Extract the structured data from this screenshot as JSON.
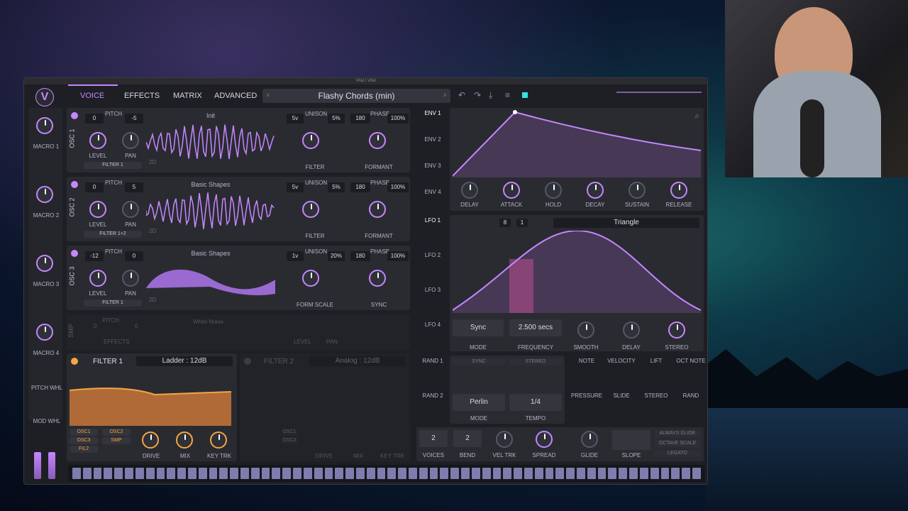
{
  "window": {
    "title": "Vital / Vital"
  },
  "tabs": [
    "VOICE",
    "EFFECTS",
    "MATRIX",
    "ADVANCED"
  ],
  "preset": {
    "name": "Flashy Chords (min)"
  },
  "macros": [
    "MACRO 1",
    "MACRO 2",
    "MACRO 3",
    "MACRO 4"
  ],
  "side": {
    "pitch_whl": "PITCH WHL",
    "mod_whl": "MOD WHL"
  },
  "osc": [
    {
      "label": "OSC 1",
      "pitch_a": "0",
      "pitch_b": "-5",
      "wave": "Init",
      "dim": "2D",
      "filter": "FILTER 1",
      "uni_a": "5v",
      "uni_b": "5%",
      "phase_a": "180",
      "phase_b": "100%",
      "knob_a": "FILTER",
      "knob_b": "FORMANT"
    },
    {
      "label": "OSC 2",
      "pitch_a": "0",
      "pitch_b": "5",
      "wave": "Basic Shapes",
      "dim": "2D",
      "filter": "FILTER 1+2",
      "uni_a": "5v",
      "uni_b": "5%",
      "phase_a": "180",
      "phase_b": "100%",
      "knob_a": "FILTER",
      "knob_b": "FORMANT"
    },
    {
      "label": "OSC 3",
      "pitch_a": "-12",
      "pitch_b": "0",
      "wave": "Basic Shapes",
      "dim": "2D",
      "filter": "FILTER 1",
      "uni_a": "1v",
      "uni_b": "20%",
      "phase_a": "180",
      "phase_b": "100%",
      "knob_a": "FORM SCALE",
      "knob_b": "SYNC"
    }
  ],
  "common": {
    "pitch": "PITCH",
    "level": "LEVEL",
    "pan": "PAN",
    "unison": "UNISON",
    "phase": "PHASE"
  },
  "smp": {
    "label": "SMP",
    "pitch": "PITCH",
    "pitch_a": "0",
    "pitch_b": "0",
    "wave": "White Noise",
    "effects": "EFFECTS",
    "level": "LEVEL",
    "pan": "PAN"
  },
  "filter1": {
    "title": "FILTER 1",
    "type": "Ladder : 12dB",
    "src": [
      "OSC1",
      "OSC2",
      "OSC3",
      "SMP",
      "FIL2"
    ],
    "knobs": [
      "DRIVE",
      "MIX",
      "KEY TRK"
    ]
  },
  "filter2": {
    "title": "FILTER 2",
    "type": "Analog : 12dB",
    "src": [
      "OSC1",
      "OSC2"
    ],
    "knobs": [
      "DRIVE",
      "MIX",
      "KEY TRK"
    ]
  },
  "env": {
    "tabs": [
      "ENV 1",
      "ENV 2",
      "ENV 3",
      "ENV 4"
    ],
    "knobs": [
      "DELAY",
      "ATTACK",
      "HOLD",
      "DECAY",
      "SUSTAIN",
      "RELEASE"
    ]
  },
  "lfo": {
    "tabs": [
      "LFO 1",
      "LFO 2",
      "LFO 3",
      "LFO 4"
    ],
    "shape": "Triangle",
    "grid_a": "8",
    "grid_b": "1",
    "mode": "Sync",
    "mode_lbl": "MODE",
    "freq": "2.500 secs",
    "freq_lbl": "FREQUENCY",
    "knobs": [
      "SMOOTH",
      "DELAY",
      "STEREO"
    ]
  },
  "rand": {
    "tabs": [
      "RAND 1",
      "RAND 2"
    ],
    "sync": "SYNC",
    "stereo": "STEREO",
    "mode": "Perlin",
    "mode_lbl": "MODE",
    "tempo": "1/4",
    "tempo_lbl": "TEMPO"
  },
  "voice_mods": {
    "row1": [
      "NOTE",
      "VELOCITY",
      "LIFT",
      "OCT NOTE"
    ],
    "row2": [
      "PRESSURE",
      "SLIDE",
      "STEREO",
      "RAND"
    ]
  },
  "bottom": {
    "voices": "2",
    "voices_lbl": "VOICES",
    "bend": "2",
    "bend_lbl": "BEND",
    "vel": "VEL TRK",
    "spread": "SPREAD",
    "glide": "GLIDE",
    "slope": "SLOPE",
    "opts": [
      "ALWAYS GLIDE",
      "OCTAVE SCALE",
      "LEGATO"
    ]
  },
  "colors": {
    "accent": "#c587ff",
    "filter": "#f5a640",
    "bg": "#1e1f24"
  }
}
